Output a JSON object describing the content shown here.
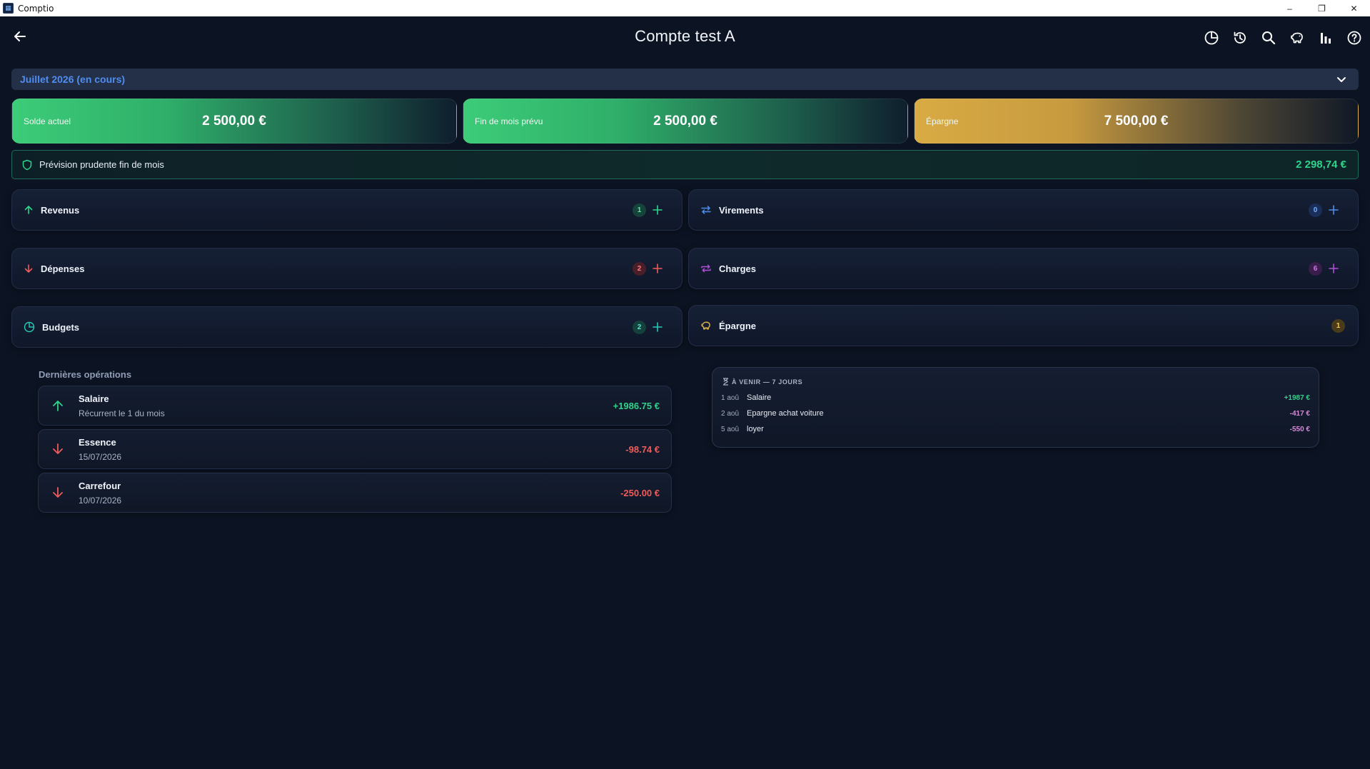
{
  "window": {
    "app_title": "Comptio",
    "minimize": "–",
    "maximize": "❐",
    "close": "✕"
  },
  "header": {
    "title": "Compte test A",
    "actions": [
      "budget-pie-icon",
      "history-icon",
      "search-icon",
      "piggy-bank-icon",
      "bar-chart-icon",
      "help-icon"
    ]
  },
  "month": {
    "label": "Juillet 2026 (en cours)"
  },
  "summary": [
    {
      "label": "Solde actuel",
      "value": "2 500,00 €",
      "color": "#3ccc78"
    },
    {
      "label": "Fin de mois prévu",
      "value": "2 500,00 €",
      "color": "#3ccc78"
    },
    {
      "label": "Épargne",
      "value": "7 500,00 €",
      "color": "#d9ab44"
    }
  ],
  "forecast": {
    "label": "Prévision prudente fin de mois",
    "value": "2 298,74 €"
  },
  "tiles": {
    "revenus": {
      "label": "Revenus",
      "count": "1",
      "color": "#2fd38b"
    },
    "virements": {
      "label": "Virements",
      "count": "0",
      "color": "#4f8df0"
    },
    "depenses": {
      "label": "Dépenses",
      "count": "2",
      "color": "#ef5b5b"
    },
    "charges": {
      "label": "Charges",
      "count": "6",
      "color": "#b14fd8"
    },
    "budgets": {
      "label": "Budgets",
      "count": "2",
      "color": "#2bc7b4"
    },
    "epargne": {
      "label": "Épargne",
      "count": "1",
      "color": "#e0b24a"
    }
  },
  "operations": {
    "title": "Dernières opérations",
    "items": [
      {
        "name": "Salaire",
        "sub": "Récurrent le 1 du mois",
        "amount": "+1986.75 €",
        "direction": "up"
      },
      {
        "name": "Essence",
        "sub": "15/07/2026",
        "amount": "-98.74 €",
        "direction": "down"
      },
      {
        "name": "Carrefour",
        "sub": "10/07/2026",
        "amount": "-250.00 €",
        "direction": "down"
      }
    ]
  },
  "upcoming": {
    "title": "À VENIR — 7 JOURS",
    "items": [
      {
        "date": "1 aoû",
        "name": "Salaire",
        "amount": "+1987 €",
        "color": "#2fd38b"
      },
      {
        "date": "2 aoû",
        "name": "Epargne achat voiture",
        "amount": "-417 €",
        "color": "#d68ad8"
      },
      {
        "date": "5 aoû",
        "name": "loyer",
        "amount": "-550 €",
        "color": "#d68ad8"
      }
    ]
  }
}
